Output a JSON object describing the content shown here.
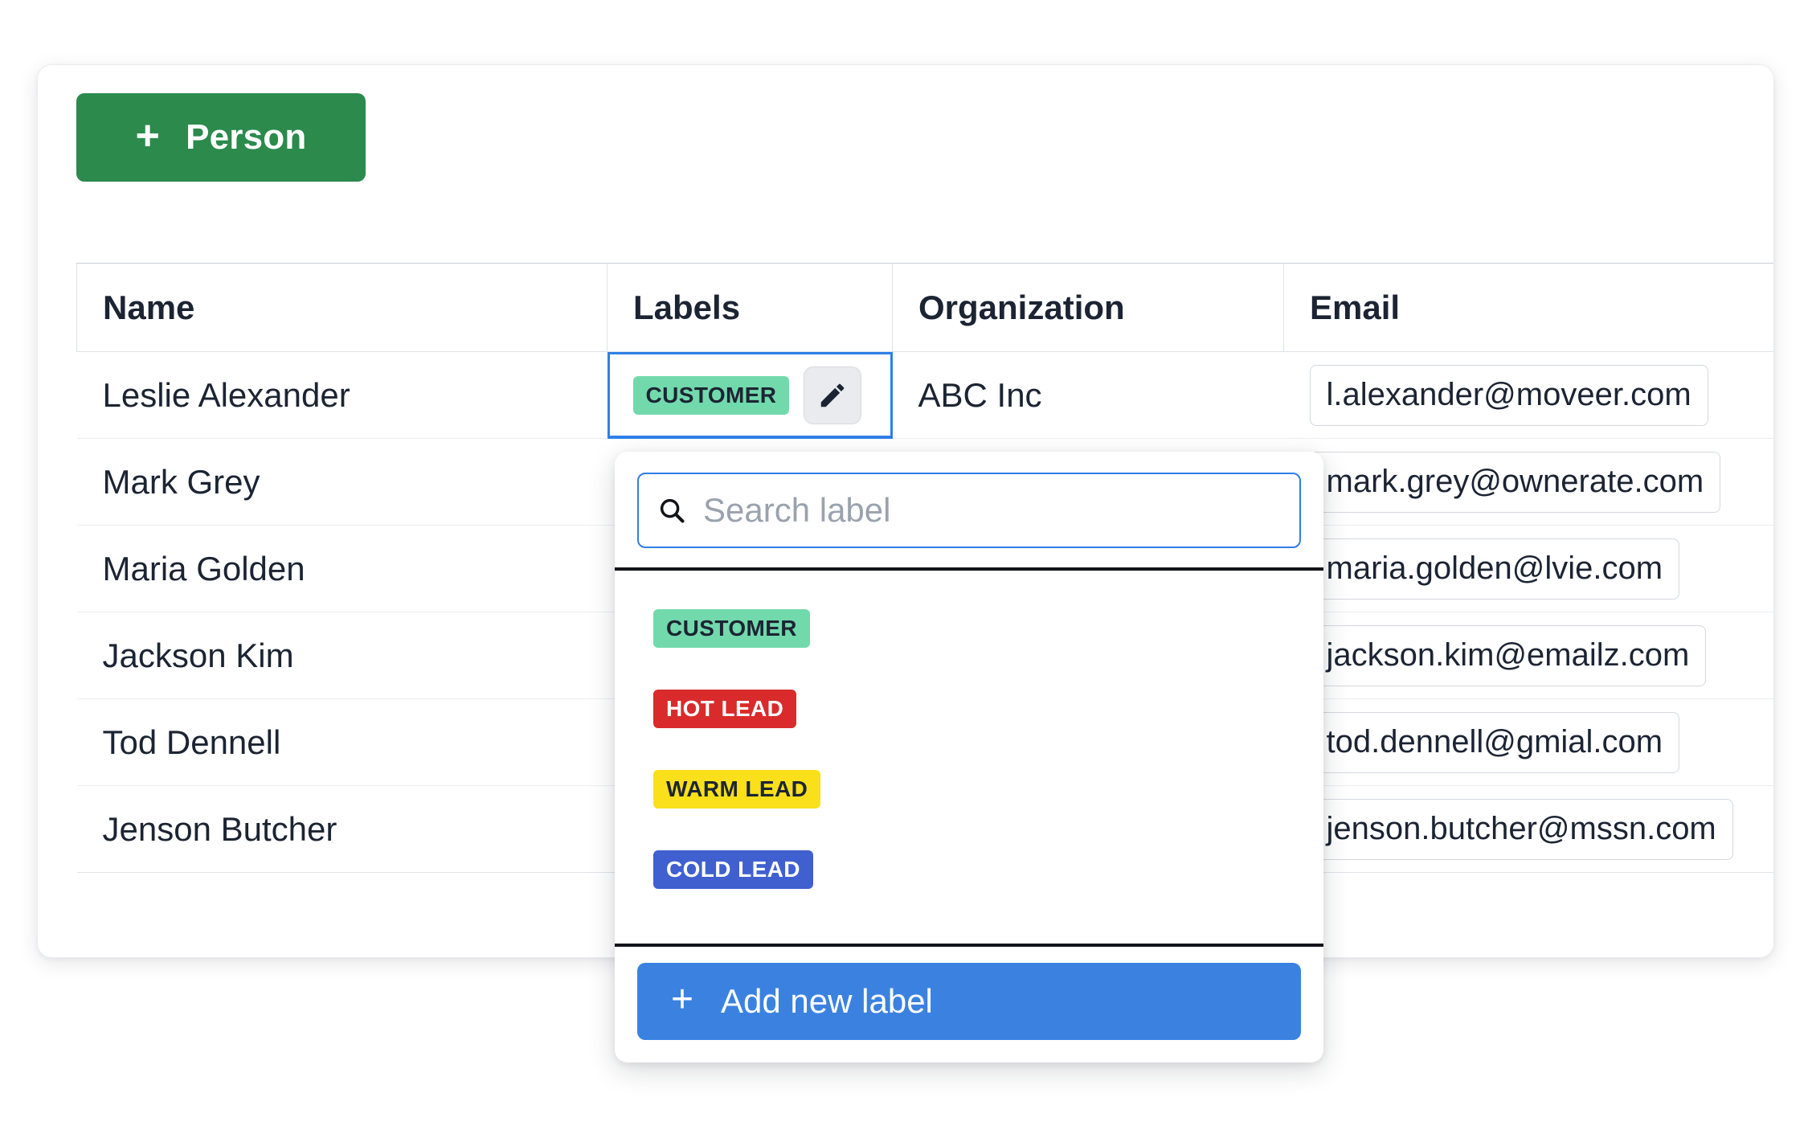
{
  "toolbar": {
    "add_person_label": "Person",
    "add_person_plus": "+"
  },
  "table": {
    "columns": [
      "Name",
      "Labels",
      "Organization",
      "Email"
    ],
    "rows": [
      {
        "name": "Leslie Alexander",
        "labels": [
          "CUSTOMER"
        ],
        "organization": "ABC Inc",
        "email": "l.alexander@moveer.com"
      },
      {
        "name": "Mark Grey",
        "labels": [],
        "organization": "",
        "email": "mark.grey@ownerate.com"
      },
      {
        "name": "Maria Golden",
        "labels": [],
        "organization": "",
        "email": "maria.golden@lvie.com"
      },
      {
        "name": "Jackson Kim",
        "labels": [],
        "organization": "",
        "email": "jackson.kim@emailz.com"
      },
      {
        "name": "Tod Dennell",
        "labels": [],
        "organization": "",
        "email": "tod.dennell@gmial.com"
      },
      {
        "name": "Jenson Butcher",
        "labels": [],
        "organization": "",
        "email": "jenson.butcher@mssn.com"
      }
    ]
  },
  "label_dropdown": {
    "search_placeholder": "Search label",
    "search_value": "",
    "options": [
      {
        "text": "CUSTOMER",
        "bg": "#72d9ac",
        "fg": "#1c2433"
      },
      {
        "text": "HOT LEAD",
        "bg": "#d92b2b",
        "fg": "#ffffff"
      },
      {
        "text": "WARM LEAD",
        "bg": "#f9e01a",
        "fg": "#1c2433"
      },
      {
        "text": "COLD LEAD",
        "bg": "#4060d0",
        "fg": "#ffffff"
      }
    ],
    "add_new_label": "Add new label",
    "add_new_plus": "+"
  },
  "colors": {
    "primary_green": "#2b8a4c",
    "primary_blue": "#3b82e0",
    "focus_blue": "#2f7fe8",
    "badge_customer": "#72d9ac",
    "badge_hot": "#d92b2b",
    "badge_warm": "#f9e01a",
    "badge_cold": "#4060d0"
  }
}
